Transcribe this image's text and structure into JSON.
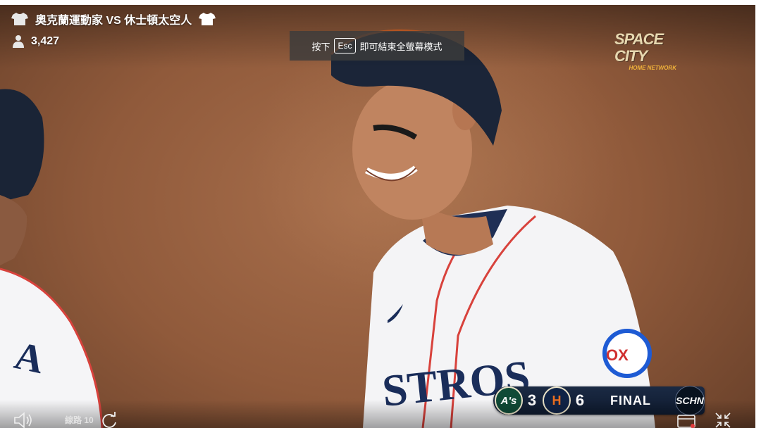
{
  "header": {
    "title": "奧克蘭運動家 VS 休士頓太空人",
    "left_team_icon": "jersey-icon",
    "right_team_icon": "jersey-icon"
  },
  "viewers": {
    "icon": "person-icon",
    "count": "3,427"
  },
  "fullscreen_toast": {
    "prefix": "按下",
    "key": "Esc",
    "suffix": "即可結束全螢幕模式"
  },
  "network_logo": {
    "line1": "SPACE CITY",
    "line2": "HOME NETWORK"
  },
  "scorebug": {
    "away_abbr": "A's",
    "away_score": "3",
    "home_abbr": "H",
    "home_score": "6",
    "status": "FINAL",
    "channel": "SCHN",
    "colors": {
      "away": "#0f4a36",
      "home": "#0f2346",
      "home_accent": "#eb6e1f"
    }
  },
  "jersey_text": {
    "player_main": "STROS",
    "player_left": "A"
  },
  "controls": {
    "volume_icon": "speaker-icon",
    "line_label": "線路 10",
    "refresh_icon": "refresh-icon",
    "cast_icon": "cast-icon",
    "exit_fullscreen_icon": "exit-fullscreen-icon"
  }
}
